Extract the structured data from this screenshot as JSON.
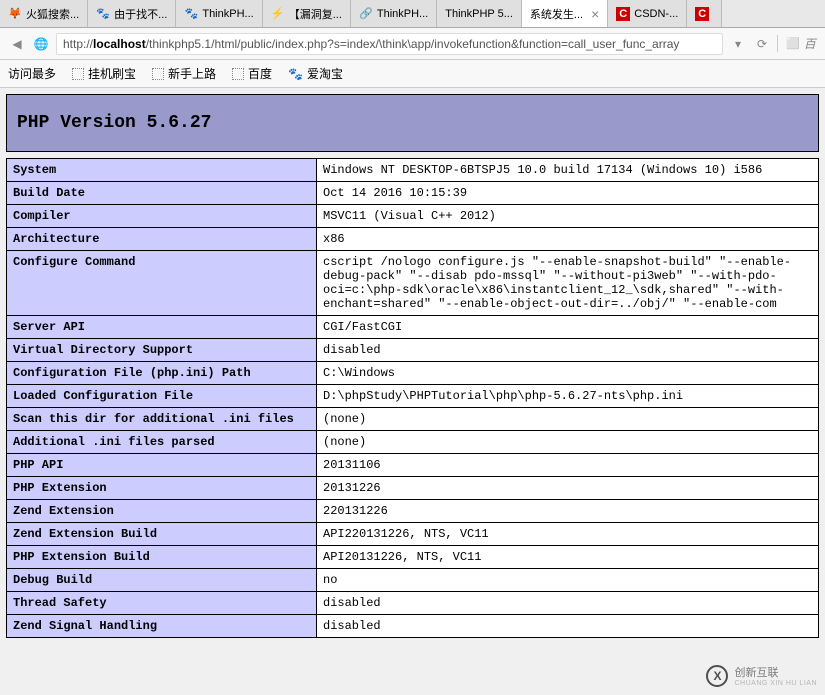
{
  "tabs": [
    {
      "icon": "🦊",
      "label": "火狐搜索...",
      "active": false
    },
    {
      "icon": "🐾",
      "label": "由于找不...",
      "active": false
    },
    {
      "icon": "🐾",
      "label": "ThinkPH...",
      "active": false
    },
    {
      "icon": "⚡",
      "label": "【漏洞复...",
      "active": false
    },
    {
      "icon": "🔗",
      "label": "ThinkPH...",
      "active": false
    },
    {
      "icon": "",
      "label": "ThinkPHP 5...",
      "active": false
    },
    {
      "icon": "",
      "label": "系统发生...",
      "active": true
    },
    {
      "icon": "C",
      "label": "CSDN-...",
      "active": false
    },
    {
      "icon": "C",
      "label": "",
      "active": false
    }
  ],
  "url": {
    "prefix": "http://",
    "host": "localhost",
    "path": "/thinkphp5.1/html/public/index.php?s=index/\\think\\app/invokefunction&function=call_user_func_array"
  },
  "search_placeholder": "百",
  "bookmarks": [
    {
      "label": "访问最多",
      "icon": ""
    },
    {
      "label": "挂机刷宝",
      "icon": "dotted"
    },
    {
      "label": "新手上路",
      "icon": "dotted"
    },
    {
      "label": "百度",
      "icon": "dotted"
    },
    {
      "label": "爱淘宝",
      "icon": "🐾"
    }
  ],
  "header": "PHP Version 5.6.27",
  "info_rows": [
    {
      "label": "System",
      "value": "Windows NT DESKTOP-6BTSPJ5 10.0 build 17134 (Windows 10) i586"
    },
    {
      "label": "Build Date",
      "value": "Oct 14 2016 10:15:39"
    },
    {
      "label": "Compiler",
      "value": "MSVC11 (Visual C++ 2012)"
    },
    {
      "label": "Architecture",
      "value": "x86"
    },
    {
      "label": "Configure Command",
      "value": "cscript /nologo configure.js \"--enable-snapshot-build\" \"--enable-debug-pack\" \"--disab pdo-mssql\" \"--without-pi3web\" \"--with-pdo-oci=c:\\php-sdk\\oracle\\x86\\instantclient_12_\\sdk,shared\" \"--with-enchant=shared\" \"--enable-object-out-dir=../obj/\" \"--enable-com"
    },
    {
      "label": "Server API",
      "value": "CGI/FastCGI"
    },
    {
      "label": "Virtual Directory Support",
      "value": "disabled"
    },
    {
      "label": "Configuration File (php.ini) Path",
      "value": "C:\\Windows"
    },
    {
      "label": "Loaded Configuration File",
      "value": "D:\\phpStudy\\PHPTutorial\\php\\php-5.6.27-nts\\php.ini"
    },
    {
      "label": "Scan this dir for additional .ini files",
      "value": "(none)"
    },
    {
      "label": "Additional .ini files parsed",
      "value": "(none)"
    },
    {
      "label": "PHP API",
      "value": "20131106"
    },
    {
      "label": "PHP Extension",
      "value": "20131226"
    },
    {
      "label": "Zend Extension",
      "value": "220131226"
    },
    {
      "label": "Zend Extension Build",
      "value": "API220131226, NTS, VC11"
    },
    {
      "label": "PHP Extension Build",
      "value": "API20131226, NTS, VC11"
    },
    {
      "label": "Debug Build",
      "value": "no"
    },
    {
      "label": "Thread Safety",
      "value": "disabled"
    },
    {
      "label": "Zend Signal Handling",
      "value": "disabled"
    }
  ],
  "watermark": {
    "main": "创新互联",
    "sub": "CHUANG XIN HU LIAN",
    "logo": "X"
  }
}
